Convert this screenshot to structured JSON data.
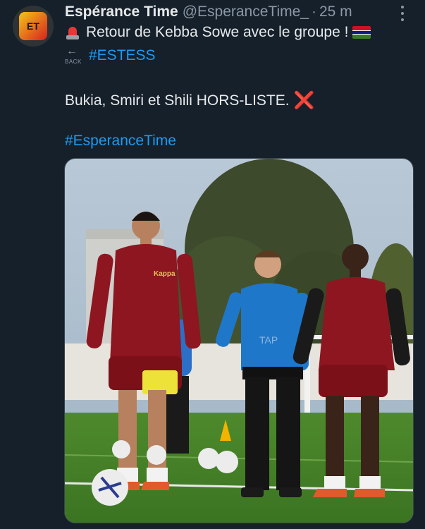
{
  "tweet": {
    "display_name": "Espérance Time",
    "handle": "@EsperanceTime_",
    "separator": "·",
    "timestamp": "25 m",
    "line1": "Retour de Kebba Sowe avec le groupe !",
    "back_label": "BACK",
    "hashtag1": "#ESTESS",
    "line3": "Bukia, Smiri et Shili HORS-LISTE.",
    "hashtag2": "#EsperanceTime"
  },
  "icons": [
    "avatar-logo",
    "siren-emoji",
    "gambia-flag-emoji",
    "back-arrow-emoji",
    "cross-mark-emoji",
    "more-icon"
  ],
  "colors": {
    "background": "#15202b",
    "link": "#1d9bf0",
    "muted": "#8b98a5",
    "kit_red": "#8e1620",
    "staff_blue": "#1f77c9"
  },
  "media": {
    "jersey_brand": "Kappa",
    "watermark": "TAP"
  }
}
